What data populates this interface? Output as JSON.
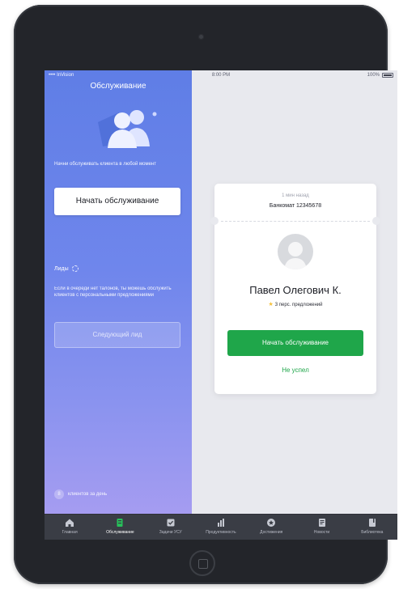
{
  "status_bar": {
    "carrier": "•••• InVision",
    "time": "8:00 PM",
    "battery": "100%"
  },
  "left_panel": {
    "title": "Обслуживание",
    "description": "Начни обслуживать клиента в любой момент",
    "start_button": "Начать обслуживание",
    "leads_label": "Лиды",
    "leads_description": "Если в очереди нет талонов, ты можешь обслужить клиентов с персональными предложениями",
    "next_lead_button": "Следующий лид",
    "clients_count": "8",
    "clients_label": "клиентов за день"
  },
  "card": {
    "time_ago": "1 мин назад",
    "atm": "Банкомат 12345678",
    "client_name": "Павел Олегович К.",
    "offers": "3 перс. предложений",
    "start_button": "Начать обслуживание",
    "missed_link": "Не успел"
  },
  "tabs": [
    {
      "label": "Главная",
      "icon": "home-icon",
      "active": false
    },
    {
      "label": "Обслуживание",
      "icon": "queue-icon",
      "active": true
    },
    {
      "label": "Задачи УСУ",
      "icon": "tasks-icon",
      "active": false
    },
    {
      "label": "Продуктивность",
      "icon": "chart-icon",
      "active": false
    },
    {
      "label": "Достижения",
      "icon": "award-icon",
      "active": false
    },
    {
      "label": "Новости",
      "icon": "news-icon",
      "active": false
    },
    {
      "label": "Библиотека",
      "icon": "library-icon",
      "active": false
    }
  ],
  "colors": {
    "accent_green": "#1fa64a",
    "panel_gradient_top": "#5f7ee6",
    "panel_gradient_bottom": "#a59cf1",
    "tabbar": "#3a3d45"
  }
}
